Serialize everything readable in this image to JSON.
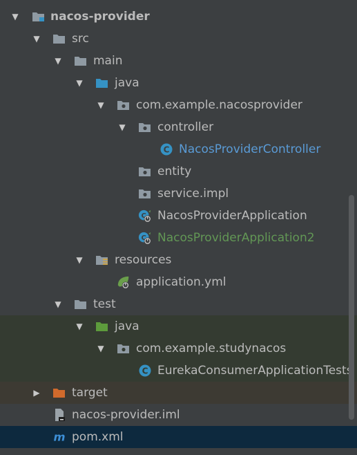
{
  "tree": {
    "items": [
      {
        "label": "nacos-provider",
        "icon": "module-folder-icon",
        "expanded": true
      },
      {
        "label": "src",
        "icon": "folder-icon",
        "expanded": true
      },
      {
        "label": "main",
        "icon": "folder-icon",
        "expanded": true
      },
      {
        "label": "java",
        "icon": "source-root-folder-icon",
        "expanded": true
      },
      {
        "label": "com.example.nacosprovider",
        "icon": "package-icon",
        "expanded": true
      },
      {
        "label": "controller",
        "icon": "package-icon",
        "expanded": true
      },
      {
        "label": "NacosProviderController",
        "icon": "java-class-icon"
      },
      {
        "label": "entity",
        "icon": "package-icon"
      },
      {
        "label": "service.impl",
        "icon": "package-icon"
      },
      {
        "label": "NacosProviderApplication",
        "icon": "spring-boot-class-icon"
      },
      {
        "label": "NacosProviderApplication2",
        "icon": "spring-boot-class-icon"
      },
      {
        "label": "resources",
        "icon": "resources-folder-icon",
        "expanded": true
      },
      {
        "label": "application.yml",
        "icon": "spring-yml-icon"
      },
      {
        "label": "test",
        "icon": "folder-icon",
        "expanded": true
      },
      {
        "label": "java",
        "icon": "test-root-folder-icon",
        "expanded": true
      },
      {
        "label": "com.example.studynacos",
        "icon": "package-icon",
        "expanded": true
      },
      {
        "label": "EurekaConsumerApplicationTests",
        "icon": "java-class-icon"
      },
      {
        "label": "target",
        "icon": "excluded-folder-icon",
        "expanded": false
      },
      {
        "label": "nacos-provider.iml",
        "icon": "iml-file-icon"
      },
      {
        "label": "pom.xml",
        "icon": "maven-icon",
        "selected": true
      }
    ]
  },
  "colors": {
    "background": "#3c3f41",
    "text": "#bbbbbb",
    "modified_blue": "#5a9bd6",
    "added_green": "#629755",
    "selection": "#0d293e",
    "test_background": "#343b31",
    "excluded_background": "#3d3a33"
  }
}
